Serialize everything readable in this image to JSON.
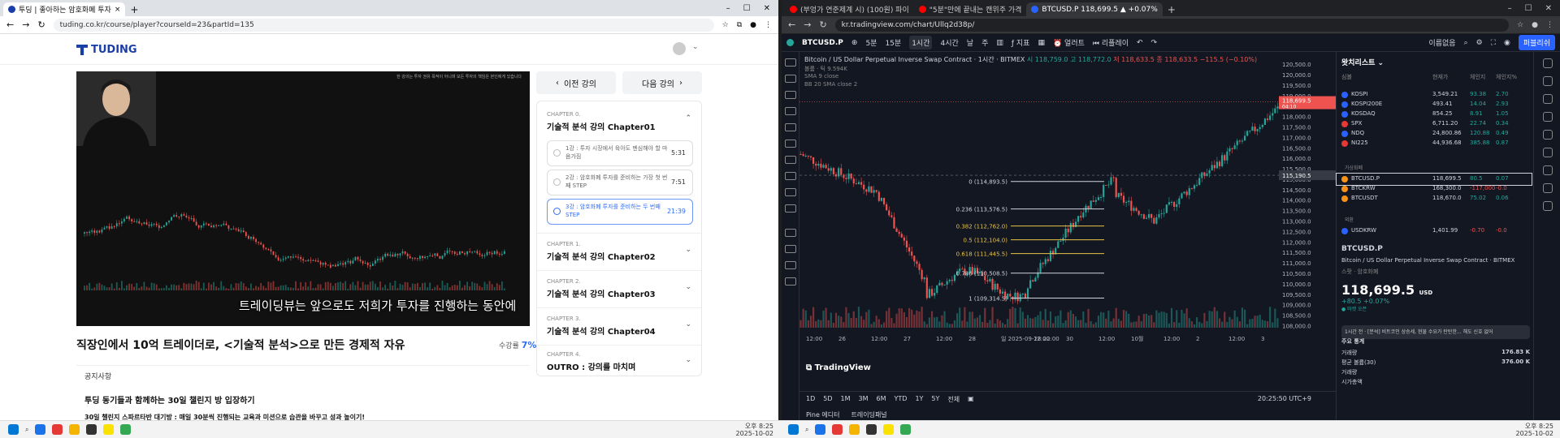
{
  "left_window": {
    "tab_title": "투딩 | 좋아하는 암호화폐 투자",
    "url": "tuding.co.kr/course/player?courseId=23&partId=135",
    "logo": "TUDING",
    "subtitle": "트레이딩뷰는 앞으로도 저희가 투자를 진행하는 동안에",
    "video_caption": "한 강의는 투자 권유 목적이 아니며 모든 투자의 책임은 본인에게 있습니다",
    "course_title": "직장인에서 10억 트레이더로, <기술적 분석>으로 만든 경제적 자유",
    "progress_label": "수강률",
    "progress_value": "7%",
    "prev_label": "이전 강의",
    "next_label": "다음 강의",
    "chapters": [
      {
        "tag": "CHAPTER 0.",
        "title": "기술적 분석 강의 Chapter01",
        "expanded": true
      },
      {
        "tag": "CHAPTER 1.",
        "title": "기술적 분석 강의 Chapter02"
      },
      {
        "tag": "CHAPTER 2.",
        "title": "기술적 분석 강의 Chapter03"
      },
      {
        "tag": "CHAPTER 3.",
        "title": "기술적 분석 강의 Chapter04"
      },
      {
        "tag": "CHAPTER 4.",
        "title": "OUTRO : 강의를 마치며"
      }
    ],
    "lessons": [
      {
        "title": "1강 : 투자 시장에서 육아도 멘심해야 할 마음가짐",
        "dur": "5:31"
      },
      {
        "title": "2강 : 암호화폐 투자를 준비하는 가장 첫 번째 STEP",
        "dur": "7:51"
      },
      {
        "title": "3강 : 암호화폐 투자를 준비하는 두 번째 STEP",
        "dur": "21:39",
        "active": true
      }
    ],
    "notice_header": "공지사항",
    "notice_title": "투딩 동기들과 함께하는 30일 챌린지 방 입장하기",
    "notice_sub": "30일 챌린지 스파르타반 대기방 : 매일 30분씩 진행되는 교육과 미션으로 습관을 바꾸고 성과 높이기!"
  },
  "right_window": {
    "tabs": [
      "(부엉가 연준제계 시) (100원) 파이",
      "\"5분\"만에 끝내는 캔위주 가격",
      "BTCUSD.P 118,699.5 ▲ +0.07%"
    ],
    "url": "kr.tradingview.com/chart/Ullq2d38p/",
    "symbol": "BTCUSD.P",
    "intervals": [
      "5분",
      "15분",
      "1시간",
      "4시간",
      "날",
      "주"
    ],
    "active_interval": "1시간",
    "toolbar": [
      "지표",
      "얼러트",
      "리플레이"
    ],
    "layout_label": "이름없음",
    "publish_label": "퍼블리쉬",
    "instrument_title": "Bitcoin / US Dollar Perpetual Inverse Swap Contract · 1시간 · BITMEX",
    "ohlc": {
      "o": "시 118,759.0",
      "h": "고 118,772.0",
      "l": "저 118,633.5",
      "c": "종 118,633.5",
      "chg": "−115.5 (−0.10%)"
    },
    "volume_label": "볼륨 · 틱  9.594K",
    "sma_label": "SMA 9 close",
    "sma2_label": "BB 20 SMA close 2",
    "fib_levels": [
      {
        "label": "0 (114,893.5)",
        "color": "#d1d4dc",
        "price": 114893.5
      },
      {
        "label": "0.236 (113,576.5)",
        "color": "#d1d4dc",
        "price": 113576.5
      },
      {
        "label": "0.382 (112,762.0)",
        "color": "#e6c34a",
        "price": 112762.0
      },
      {
        "label": "0.5 (112,104.0)",
        "color": "#e6c34a",
        "price": 112104.0
      },
      {
        "label": "0.618 (111,445.5)",
        "color": "#e6c34a",
        "price": 111445.5
      },
      {
        "label": "0.786 (110,508.5)",
        "color": "#d1d4dc",
        "price": 110508.5
      },
      {
        "label": "1 (109,314.5)",
        "color": "#d1d4dc",
        "price": 109314.5
      }
    ],
    "price_ticks": [
      "120,500.0",
      "120,000.0",
      "119,500.0",
      "119,000.0",
      "118,500.0",
      "118,000.0",
      "117,500.0",
      "117,000.0",
      "116,500.0",
      "116,000.0",
      "115,500.0",
      "115,000.0",
      "114,500.0",
      "114,000.0",
      "113,500.0",
      "113,000.0",
      "112,500.0",
      "112,000.0",
      "111,500.0",
      "111,000.0",
      "110,500.0",
      "110,000.0",
      "109,500.0",
      "109,000.0",
      "108,500.0",
      "108,000.0"
    ],
    "last_price_label": "118,699.5",
    "last_price_time": "04:10",
    "crosshair_price": "115,190.5",
    "time_ticks": [
      "12:00",
      "26",
      "12:00",
      "27",
      "12:00",
      "28",
      "일 2025-09-28  22:00",
      "12:00",
      "30",
      "12:00",
      "10월",
      "12:00",
      "2",
      "12:00",
      "3"
    ],
    "tv_logo": "TradingView",
    "timeframes": [
      "1D",
      "5D",
      "1M",
      "3M",
      "6M",
      "YTD",
      "1Y",
      "5Y",
      "전체"
    ],
    "timezone": "20:25:50 UTC+9",
    "bottom_tabs": [
      "Pine 에디터",
      "트레이딩패널"
    ],
    "watchlist_title": "왓치리스트",
    "watch_cols": [
      "심볼",
      "현재가",
      "체인지",
      "체인지%"
    ],
    "watchlist": [
      {
        "name": "KOSPI",
        "price": "3,549.21",
        "chg": "93.38",
        "pct": "2.70",
        "color": "#2962ff"
      },
      {
        "name": "KOSPI200E",
        "price": "493.41",
        "chg": "14.04",
        "pct": "2.93",
        "color": "#2962ff"
      },
      {
        "name": "KOSDAQ",
        "price": "854.25",
        "chg": "8.91",
        "pct": "1.05",
        "color": "#2962ff"
      },
      {
        "name": "SPX",
        "price": "6,711.20",
        "chg": "22.74",
        "pct": "0.34",
        "color": "#e53935"
      },
      {
        "name": "NDQ",
        "price": "24,800.86",
        "chg": "120.88",
        "pct": "0.49",
        "color": "#2962ff"
      },
      {
        "name": "NI225",
        "price": "44,936.68",
        "chg": "385.88",
        "pct": "0.87",
        "color": "#e53935"
      },
      {
        "name": "BTCUSD.P",
        "price": "118,699.5",
        "chg": "80.5",
        "pct": "0.07",
        "color": "#f7931a",
        "selected": true
      },
      {
        "name": "BTCKRW",
        "price": "168,300.0",
        "chg": "-117,000",
        "pct": "-0.0",
        "color": "#f7931a",
        "neg": true
      },
      {
        "name": "BTCUSDT",
        "price": "118,670.0",
        "chg": "75.02",
        "pct": "0.06",
        "color": "#f7931a"
      },
      {
        "name": "USDKRW",
        "price": "1,401.99",
        "chg": "-0.70",
        "pct": "-0.0",
        "color": "#2962ff",
        "neg": true
      }
    ],
    "groups": [
      "지표",
      "가상화폐",
      "외환"
    ],
    "detail": {
      "symbol": "BTCUSD.P",
      "name": "Bitcoin / US Dollar Perpetual Inverse Swap Contract · BITMEX",
      "type": "스팟 · 암호화폐",
      "price": "118,699.5",
      "unit": "USD",
      "change": "+80.5 +0.07%",
      "status": "● 마켓 오픈",
      "news": "1시간 전 · [분석] 비트코인 상승세, 현물 수요가 탄탄한... 해도 신호 없어"
    },
    "stats_title": "주요 통계",
    "stats": [
      {
        "k": "거래량",
        "v": "176.83 K"
      },
      {
        "k": "평균 볼륨(30)",
        "v": "376.00 K"
      },
      {
        "k": "거래량",
        "v": ""
      },
      {
        "k": "시가총액",
        "v": ""
      }
    ]
  },
  "taskbar": {
    "left_clock": "오후 8:25\n2025-10-02",
    "right_clock": "오후 8:25\n2025-10-02"
  }
}
